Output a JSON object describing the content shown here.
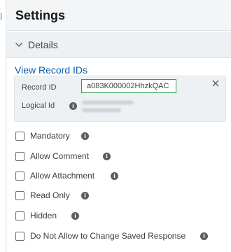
{
  "panel": {
    "title": "Settings"
  },
  "details": {
    "section_label": "Details",
    "view_ids_link": "View Record IDs",
    "record_id_label": "Record ID",
    "record_id_value": "a083K000002HhzkQAC",
    "logical_id_label": "Logical Id"
  },
  "checkboxes": [
    {
      "label": "Mandatory",
      "checked": false
    },
    {
      "label": "Allow Comment",
      "checked": false
    },
    {
      "label": "Allow Attachment",
      "checked": false
    },
    {
      "label": "Read Only",
      "checked": false
    },
    {
      "label": "Hidden",
      "checked": false
    },
    {
      "label": "Do Not Allow to Change Saved Response",
      "checked": false
    }
  ],
  "colors": {
    "link": "#0b5cab",
    "highlight_border": "#2e9e4a",
    "info_icon": "#5c5c5c"
  }
}
